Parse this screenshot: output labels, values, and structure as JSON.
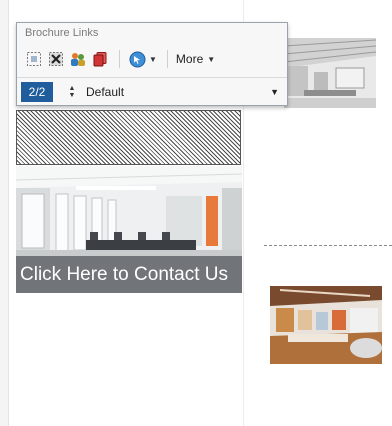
{
  "toolbar": {
    "title": "Brochure Links",
    "icons": [
      "select-frame-icon",
      "delete-link-icon",
      "people-icon",
      "stack-red-icon",
      "navigate-arrow-icon"
    ],
    "more_label": "More",
    "page_indicator": "2/2",
    "layout_label": "Default"
  },
  "content": {
    "promo_caption": "Click Here to Contact Us"
  },
  "colors": {
    "badge": "#1f5d9c",
    "caption_overlay": "#282d37"
  }
}
